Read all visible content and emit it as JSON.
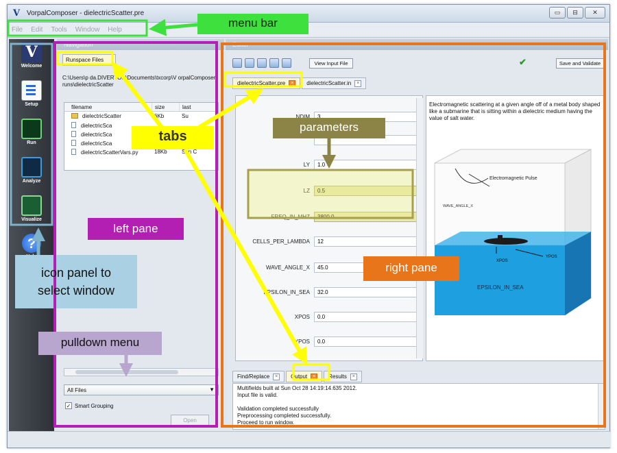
{
  "window": {
    "logo": "V",
    "title": "VorpalComposer - dielectricScatter.pre",
    "min_label": "▭",
    "max_label": "⊟",
    "close_label": "✕"
  },
  "menubar": {
    "items": [
      "File",
      "Edit",
      "Tools",
      "Window",
      "Help"
    ]
  },
  "icon_panel": {
    "items": [
      {
        "label": "Welcome",
        "glyph": "V"
      },
      {
        "label": "Setup",
        "glyph": ""
      },
      {
        "label": "Run",
        "glyph": ""
      },
      {
        "label": "Analyze",
        "glyph": ""
      },
      {
        "label": "Visualize",
        "glyph": ""
      },
      {
        "label": "Help",
        "glyph": "?"
      }
    ]
  },
  "navigation": {
    "title": "Navigation",
    "tab": "Runspace Files",
    "path": "C:\\Users\\p   da.DIVERTOR\\Documents\\txcorp\\V orpalComposer     runs\\dielectricScatter",
    "columns": [
      "filename",
      "size",
      "last"
    ],
    "rows": [
      {
        "name": "dielectricScatter",
        "size": "6Kb",
        "last": "Su",
        "kind": "folder"
      },
      {
        "name": "dielectricSca",
        "size": "",
        "last": "",
        "kind": "file"
      },
      {
        "name": "dielectricSca",
        "size": "",
        "last": "",
        "kind": "file"
      },
      {
        "name": "dielectricSca",
        "size": "",
        "last": "",
        "kind": "file"
      },
      {
        "name": "dielectricScatterVars.py",
        "size": "18Kb",
        "last": "Sun C",
        "kind": "file"
      }
    ],
    "filter_value": "All Files",
    "smart_grouping_label": "Smart Grouping",
    "smart_grouping_checked": "✓",
    "open_label": "Open"
  },
  "editor": {
    "title": "Editor",
    "view_input_label": "View Input File",
    "save_validate_label": "Save and Validate",
    "tabs": [
      {
        "label": "dielectricScatter.pre",
        "active": true
      },
      {
        "label": "dielectricScatter.in",
        "active": false
      }
    ],
    "params": [
      {
        "name": "NDIM",
        "value": "3"
      },
      {
        "name": "",
        "value": ""
      },
      {
        "name": "LY",
        "value": "1.0"
      },
      {
        "name": "LZ",
        "value": "0.5"
      },
      {
        "name": "FREQ_IN_MHZ",
        "value": "3800.0"
      },
      {
        "name": "CELLS_PER_LAMBDA",
        "value": "12"
      },
      {
        "name": "WAVE_ANGLE_X",
        "value": "45.0"
      },
      {
        "name": "EPSILON_IN_SEA",
        "value": "32.0"
      },
      {
        "name": "XPOS",
        "value": "0.0"
      },
      {
        "name": "YPOS",
        "value": "0.0"
      }
    ],
    "description": "Electromagnetic scattering at a given angle off of a metal body shaped like a submarine that is sitting within a dielectric medium having the value of salt water.",
    "figure": {
      "pulse_label": "Electromagnetic Pulse",
      "angle_label": "WAVE_ANGLE_X",
      "xpos_label": "XPOS",
      "ypos_label": "YPOS",
      "sea_label": "EPSILON_IN_SEA",
      "sea_color": "#1e9fe0",
      "box_color": "#f4f4f4"
    },
    "bottom_tabs": [
      {
        "label": "Find/Replace",
        "active": false
      },
      {
        "label": "Output",
        "active": true
      },
      {
        "label": "Results",
        "active": false
      }
    ],
    "output_lines": [
      "Multifields built at Sun Oct 28 14:19:14.635 2012.",
      "Input file is valid.",
      "",
      "Validation completed successfully",
      "Preprocessing completed successfully.",
      "Proceed to run window."
    ]
  },
  "annotations": {
    "menu_bar": "menu bar",
    "tabs": "tabs",
    "parameters": "parameters",
    "left_pane": "left pane",
    "right_pane": "right pane",
    "icon_panel_line1": "icon panel to",
    "icon_panel_line2": "select window",
    "pulldown_menu": "pulldown menu",
    "colors": {
      "green": "#3ee03e",
      "yellow": "#ffff00",
      "magenta": "#b21fb2",
      "orange": "#e8751a",
      "olive": "#8c8446",
      "steel": "#7fb3cc",
      "lavender": "#b8a6cf"
    }
  }
}
